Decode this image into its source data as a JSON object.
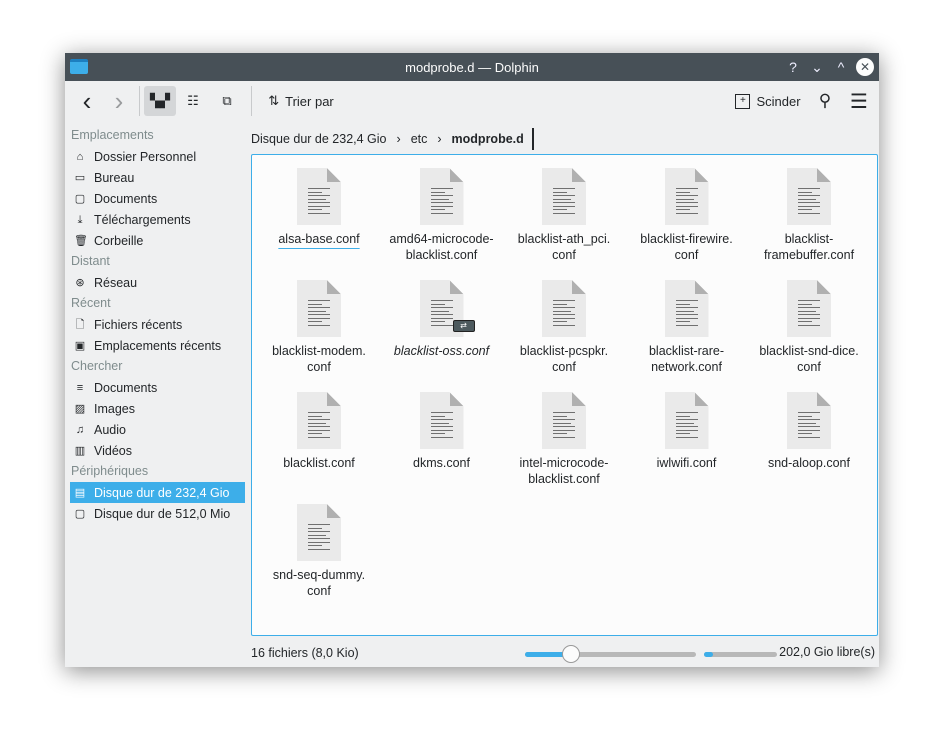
{
  "window": {
    "title": "modprobe.d — Dolphin",
    "help": "?",
    "minimize": "⌄",
    "maximize": "^",
    "close": "✕"
  },
  "toolbar": {
    "back": "‹",
    "forward": "›",
    "sort_label": "Trier par",
    "split_label": "Scinder"
  },
  "sidebar": {
    "sections": [
      {
        "title": "Emplacements",
        "items": [
          {
            "label": "Dossier Personnel",
            "icon": "home-icon",
            "glyph": "⌂"
          },
          {
            "label": "Bureau",
            "icon": "desktop-icon",
            "glyph": "▭"
          },
          {
            "label": "Documents",
            "icon": "documents-icon",
            "glyph": "▢"
          },
          {
            "label": "Téléchargements",
            "icon": "download-icon",
            "glyph": "⤓"
          },
          {
            "label": "Corbeille",
            "icon": "trash-icon",
            "glyph": "🗑"
          }
        ]
      },
      {
        "title": "Distant",
        "items": [
          {
            "label": "Réseau",
            "icon": "network-icon",
            "glyph": "⊛"
          }
        ]
      },
      {
        "title": "Récent",
        "items": [
          {
            "label": "Fichiers récents",
            "icon": "recent-files-icon",
            "glyph": "🗋"
          },
          {
            "label": "Emplacements récents",
            "icon": "recent-locations-icon",
            "glyph": "▣"
          }
        ]
      },
      {
        "title": "Chercher",
        "items": [
          {
            "label": "Documents",
            "icon": "text-icon",
            "glyph": "≡"
          },
          {
            "label": "Images",
            "icon": "image-icon",
            "glyph": "▨"
          },
          {
            "label": "Audio",
            "icon": "music-icon",
            "glyph": "♫"
          },
          {
            "label": "Vidéos",
            "icon": "video-icon",
            "glyph": "▥"
          }
        ]
      },
      {
        "title": "Périphériques",
        "items": [
          {
            "label": "Disque dur de 232,4 Gio",
            "icon": "harddisk-icon",
            "glyph": "▤",
            "selected": true
          },
          {
            "label": "Disque dur de 512,0 Mio",
            "icon": "harddisk-icon",
            "glyph": "▢"
          }
        ]
      }
    ]
  },
  "breadcrumb": [
    "Disque dur de 232,4 Gio",
    "etc",
    "modprobe.d"
  ],
  "files": [
    {
      "name": "alsa-base.conf",
      "hover": true
    },
    {
      "name": "amd64-microcode-\nblacklist.conf"
    },
    {
      "name": "blacklist-ath_pci.\nconf"
    },
    {
      "name": "blacklist-firewire.\nconf"
    },
    {
      "name": "blacklist-\nframebuffer.conf"
    },
    {
      "name": "blacklist-modem.\nconf"
    },
    {
      "name": "blacklist-oss.conf",
      "symlink": true
    },
    {
      "name": "blacklist-pcspkr.\nconf"
    },
    {
      "name": "blacklist-rare-\nnetwork.conf"
    },
    {
      "name": "blacklist-snd-dice.\nconf"
    },
    {
      "name": "blacklist.conf"
    },
    {
      "name": "dkms.conf"
    },
    {
      "name": "intel-microcode-\nblacklist.conf"
    },
    {
      "name": "iwlwifi.conf"
    },
    {
      "name": "snd-aloop.conf"
    },
    {
      "name": "snd-seq-dummy.\nconf"
    }
  ],
  "status": {
    "summary": "16 fichiers (8,0 Kio)",
    "zoom_fraction": 0.27,
    "free_label": "202,0 Gio libre(s)",
    "used_fraction": 0.13
  }
}
